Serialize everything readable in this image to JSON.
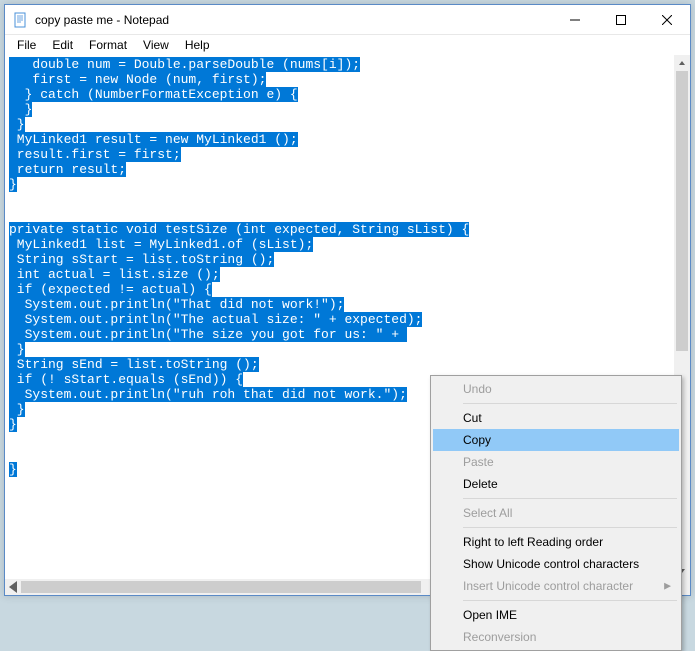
{
  "window": {
    "title": "copy paste me - Notepad"
  },
  "menubar": {
    "file": "File",
    "edit": "Edit",
    "format": "Format",
    "view": "View",
    "help": "Help"
  },
  "editor": {
    "lines": [
      "   double num = Double.parseDouble (nums[i]);",
      "   first = new Node (num, first);",
      "  } catch (NumberFormatException e) {",
      "  }",
      " }",
      " MyLinked1 result = new MyLinked1 ();",
      " result.first = first;",
      " return result;",
      "}",
      "",
      "",
      "private static void testSize (int expected, String sList) {",
      " MyLinked1 list = MyLinked1.of (sList);",
      " String sStart = list.toString ();",
      " int actual = list.size ();",
      " if (expected != actual) {",
      "  System.out.println(\"That did not work!\");",
      "  System.out.println(\"The actual size: \" + expected);",
      "  System.out.println(\"The size you got for us: \" + ",
      " }",
      " String sEnd = list.toString ();",
      " if (! sStart.equals (sEnd)) {",
      "  System.out.println(\"ruh roh that did not work.\");",
      " }",
      "}",
      "",
      "",
      "}"
    ]
  },
  "context_menu": {
    "undo": "Undo",
    "cut": "Cut",
    "copy": "Copy",
    "paste": "Paste",
    "delete": "Delete",
    "select_all": "Select All",
    "rtl": "Right to left Reading order",
    "show_unicode": "Show Unicode control characters",
    "insert_unicode": "Insert Unicode control character",
    "open_ime": "Open IME",
    "reconversion": "Reconversion"
  }
}
